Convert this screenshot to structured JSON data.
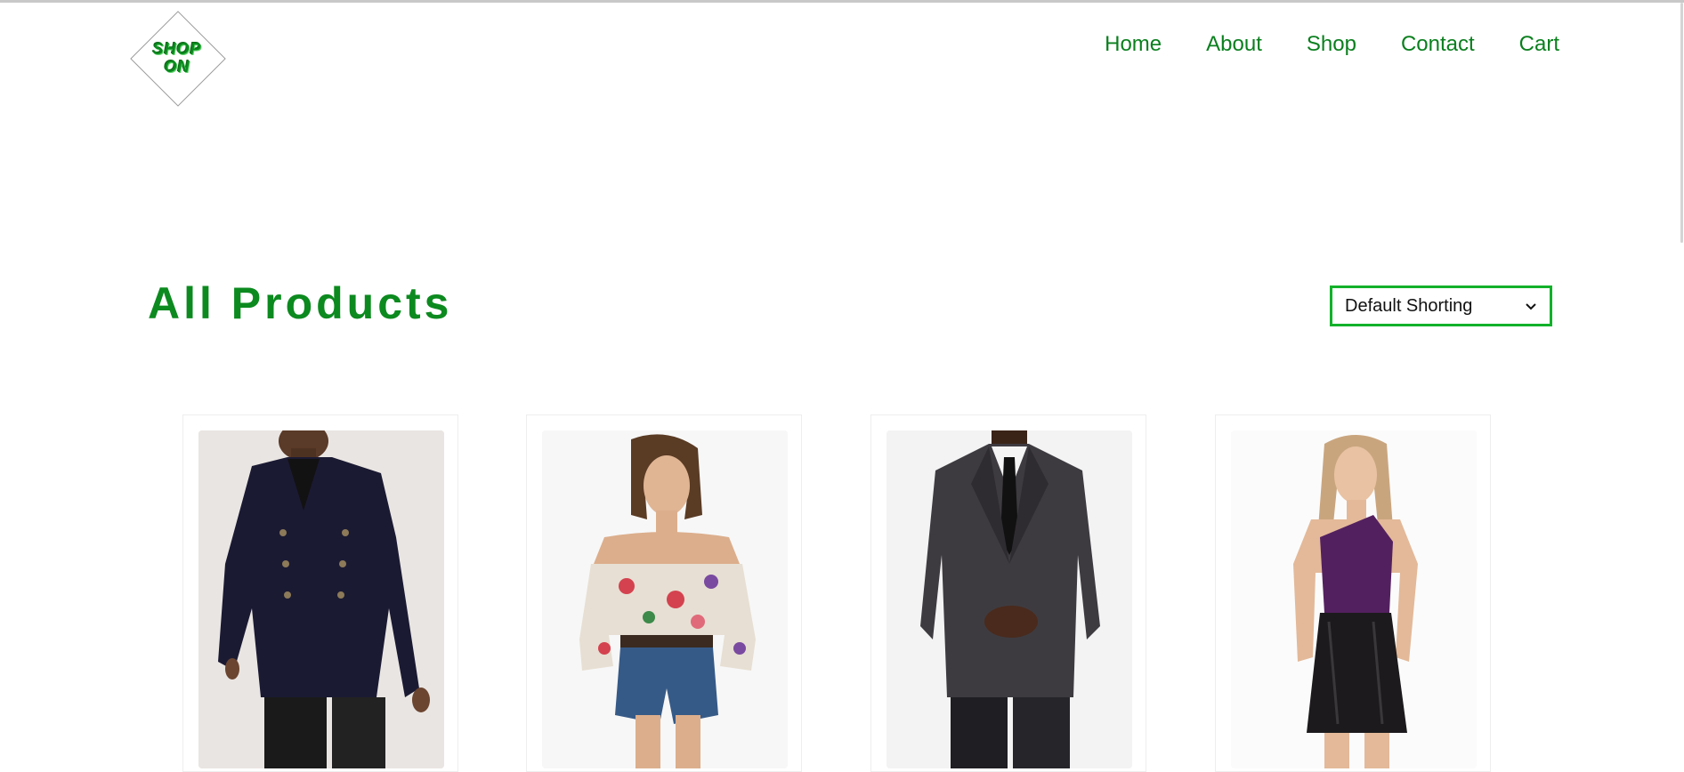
{
  "brand": {
    "logo_text_line1": "SHOP",
    "logo_text_line2": "ON"
  },
  "nav": {
    "items": [
      "Home",
      "About",
      "Shop",
      "Contact",
      "Cart"
    ]
  },
  "main": {
    "title": "All Products",
    "sort": {
      "selected": "Default Shorting"
    }
  },
  "products": [
    {
      "name": "navy double-breasted blazer"
    },
    {
      "name": "floral off-shoulder top"
    },
    {
      "name": "charcoal suit"
    },
    {
      "name": "purple one-shoulder top with leather skirt"
    }
  ],
  "colors": {
    "accent": "#0c8a1f",
    "select_border": "#12b12a"
  }
}
